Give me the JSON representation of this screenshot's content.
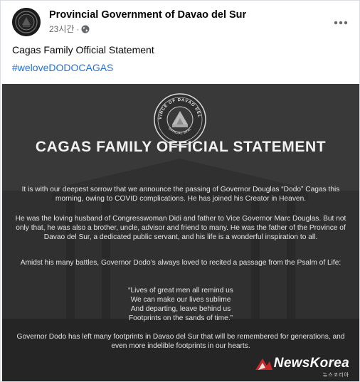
{
  "post": {
    "page_name": "Provincial Government of Davao del Sur",
    "timestamp": "23시간",
    "separator": "·",
    "privacy_icon": "globe-icon",
    "more_icon": "more-horizontal-icon",
    "caption": "Cagas Family Official Statement",
    "hashtag": "#weloveDODOCAGAS"
  },
  "image": {
    "seal": {
      "outer_text": "PROVINCE OF DAVAO DEL SUR",
      "inner_text": "OFFICIAL SEAL"
    },
    "headline": "CAGAS FAMILY OFFICIAL STATEMENT",
    "paragraphs": [
      "It is with our deepest sorrow that we announce the passing of Governor Douglas “Dodo” Cagas this morning, owing to COVID complications. He has joined his Creator in Heaven.",
      "He was the loving husband of Congresswoman Didi and father to Vice Governor Marc Douglas. But not only that, he was also a brother, uncle, advisor and friend to many. He was the father of the Province of Davao del Sur, a dedicated public servant, and his life is a wonderful inspiration to all.",
      "Amidst his many battles, Governor Dodo’s always loved to recited a passage from the Psalm of Life:",
      "“Lives of great men all remind us\nWe can make our lives sublime\nAnd departing, leave behind us\nFootprints on the sands of time.”",
      "Governor Dodo has left many footprints in Davao del Sur that will be remembered for generations, and even more indelible footprints in our hearts."
    ]
  },
  "watermark": {
    "brand": "NewsKorea",
    "sub": "뉴스코리아"
  },
  "colors": {
    "hashtag": "#216fdb",
    "meta": "#65676b",
    "image_bg": "#3e3e3e",
    "headline": "#f2f2f2"
  }
}
